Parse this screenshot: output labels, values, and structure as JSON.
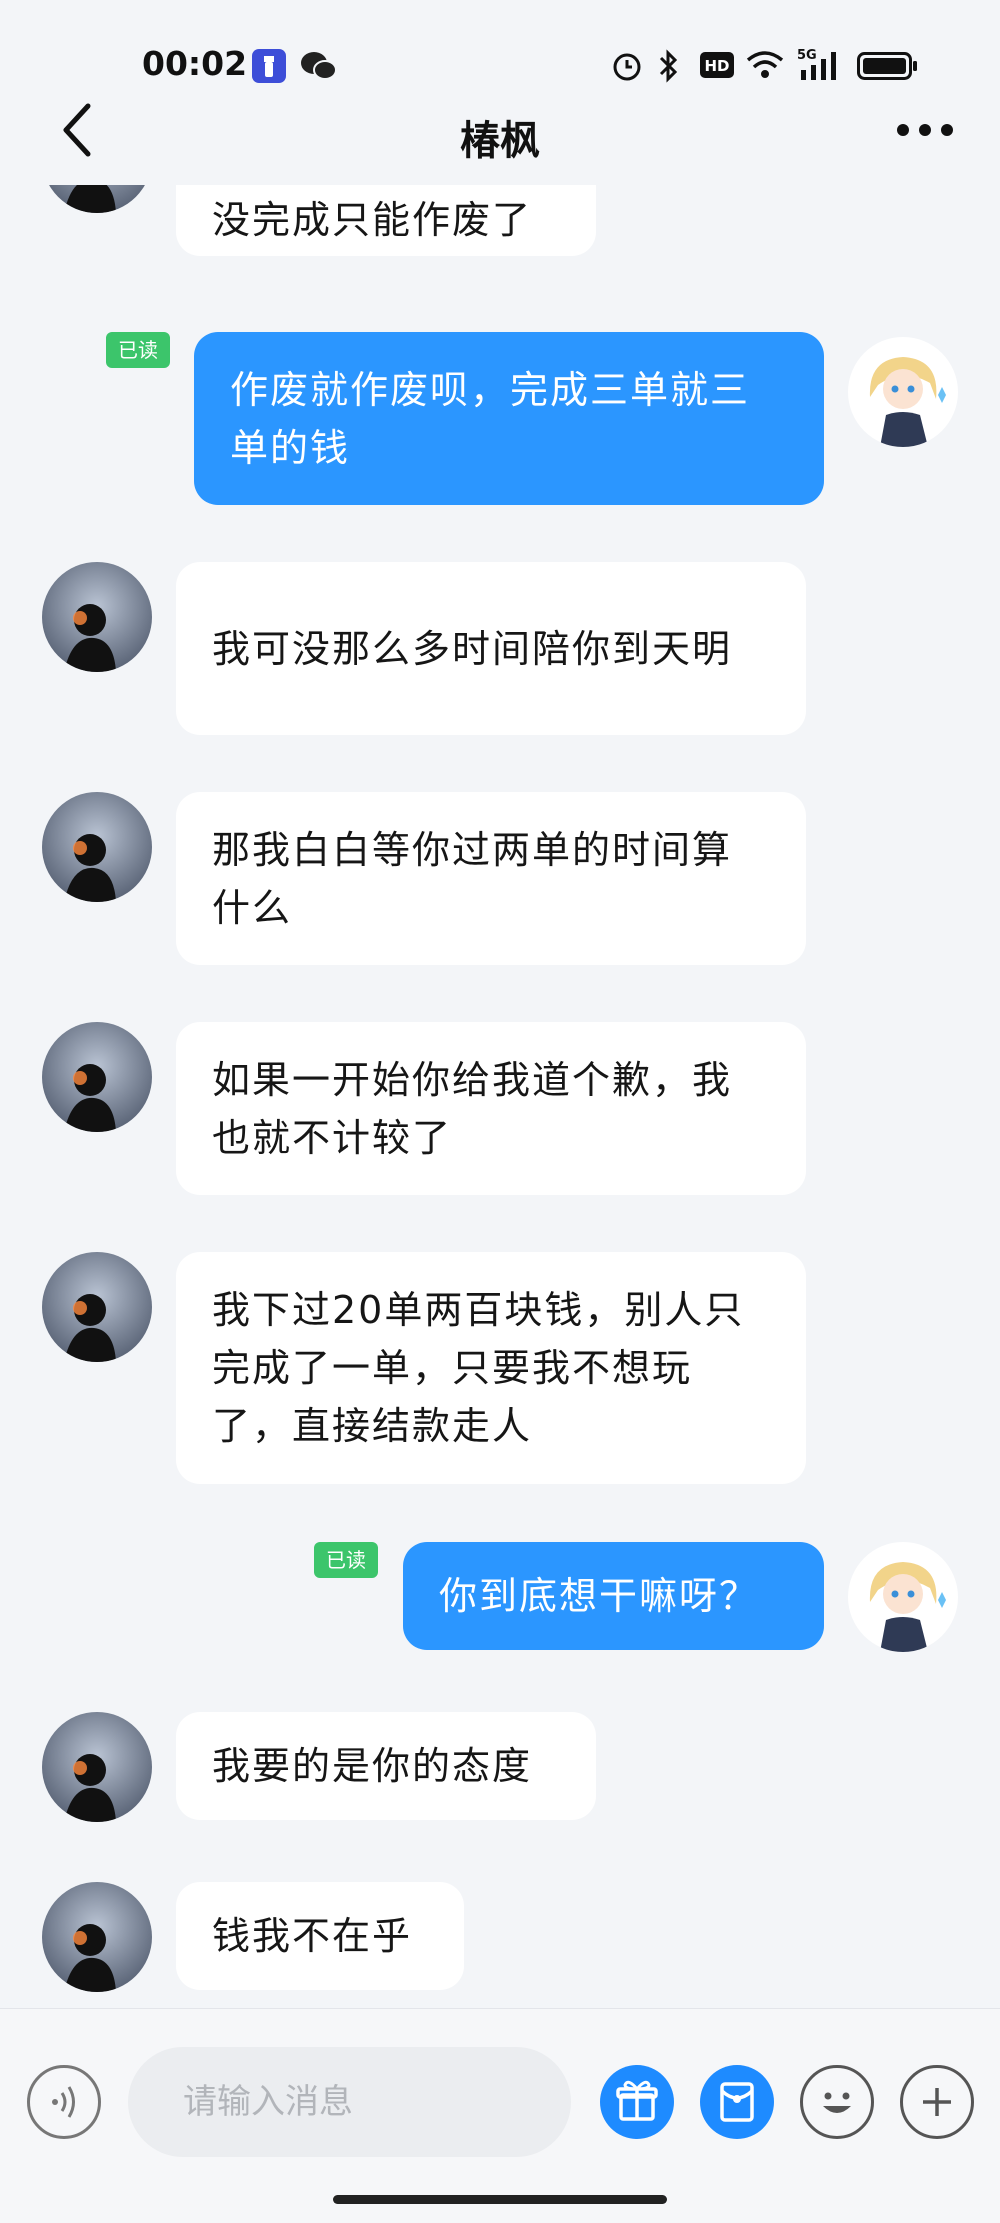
{
  "status_bar": {
    "time": "00:02",
    "icons": [
      "flashlight-app-icon",
      "wechat-icon",
      "alarm-icon",
      "bluetooth-icon",
      "hd-icon",
      "wifi-icon",
      "signal-5g-icon",
      "battery-icon"
    ]
  },
  "header": {
    "title": "椿枫"
  },
  "messages": [
    {
      "side": "in",
      "text": "没完成只能作废了"
    },
    {
      "side": "out",
      "badge": "已读",
      "text": "作废就作废呗，完成三单就三单的钱"
    },
    {
      "side": "in",
      "text": "我可没那么多时间陪你到天明"
    },
    {
      "side": "in",
      "text": "那我白白等你过两单的时间算什么"
    },
    {
      "side": "in",
      "text": "如果一开始你给我道个歉，我也就不计较了"
    },
    {
      "side": "in",
      "text": "我下过20单两百块钱，别人只完成了一单，只要我不想玩了，直接结款走人"
    },
    {
      "side": "out",
      "badge": "已读",
      "text": "你到底想干嘛呀？"
    },
    {
      "side": "in",
      "text": "我要的是你的态度"
    },
    {
      "side": "in",
      "text": "钱我不在乎"
    }
  ],
  "input": {
    "placeholder": "请输入消息"
  },
  "colors": {
    "outgoing_bubble": "#2b96ff",
    "incoming_bubble": "#ffffff",
    "read_badge": "#3cc56b",
    "background": "#f3f5f8"
  }
}
